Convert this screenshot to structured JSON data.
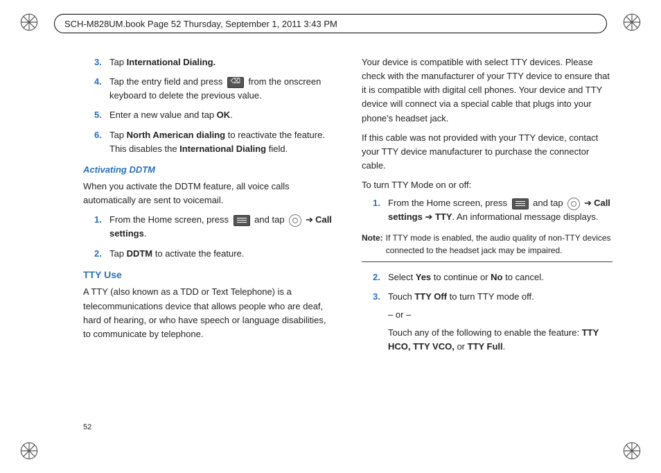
{
  "header": {
    "text": "SCH-M828UM.book  Page 52  Thursday, September 1, 2011  3:43 PM"
  },
  "left": {
    "step3_a": "Tap ",
    "step3_b": "International Dialing.",
    "step4_a": "Tap the entry field and press ",
    "step4_b": " from the onscreen keyboard to delete the previous value.",
    "step5_a": "Enter a new value and tap ",
    "step5_ok": "OK",
    "step5_b": ".",
    "step6_a": "Tap ",
    "step6_bold1": "North American dialing",
    "step6_b": " to reactivate the feature. This disables the ",
    "step6_bold2": "International Dialing",
    "step6_c": " field.",
    "ddtm_head": "Activating DDTM",
    "ddtm_p": "When you activate the DDTM feature, all voice calls automatically are sent to voicemail.",
    "ddtm1_a": "From the Home screen, press ",
    "ddtm1_b": " and tap ",
    "ddtm1_bold": "Call settings",
    "ddtm1_c": ".",
    "ddtm2_a": "Tap ",
    "ddtm2_bold": "DDTM",
    "ddtm2_b": " to activate the feature.",
    "tty_head": "TTY Use",
    "tty_p": "A TTY (also known as a TDD or Text Telephone) is a telecommunications device that allows people who are deaf, hard of hearing, or who have speech or language disabilities, to communicate by telephone."
  },
  "right": {
    "p1": "Your device is compatible with select TTY devices. Please check with the manufacturer of your TTY device to ensure that it is compatible with digital cell phones. Your device and TTY device will connect via a special cable that plugs into your phone's headset jack.",
    "p2": "If this cable was not provided with your TTY device, contact your TTY device manufacturer to purchase the connector cable.",
    "p3": "To turn TTY Mode on or off:",
    "s1_a": "From the Home screen, press ",
    "s1_b": " and tap ",
    "s1_bold1": "Call settings",
    "s1_arrow": " ➔ ",
    "s1_bold2": "TTY",
    "s1_c": ". An informational message displays.",
    "note_label": "Note:",
    "note_body": "If TTY mode is enabled, the audio quality of non-TTY devices connected to the headset jack may be impaired.",
    "s2_a": "Select ",
    "s2_yes": "Yes",
    "s2_b": " to continue or ",
    "s2_no": "No",
    "s2_c": " to cancel.",
    "s3_a": "Touch ",
    "s3_bold": "TTY Off",
    "s3_b": " to turn TTY mode off.",
    "s3_or": "– or –",
    "s3_c": "Touch any of the following to enable the feature: ",
    "s3_opt1": "TTY HCO,",
    "s3_opt2": " TTY VCO,",
    "s3_opt3_a": " or ",
    "s3_opt3_b": "TTY Full",
    "s3_d": "."
  },
  "nums": {
    "n3": "3.",
    "n4": "4.",
    "n5": "5.",
    "n6": "6.",
    "n1": "1.",
    "n2": "2."
  },
  "page_number": "52",
  "arrow": "➔"
}
